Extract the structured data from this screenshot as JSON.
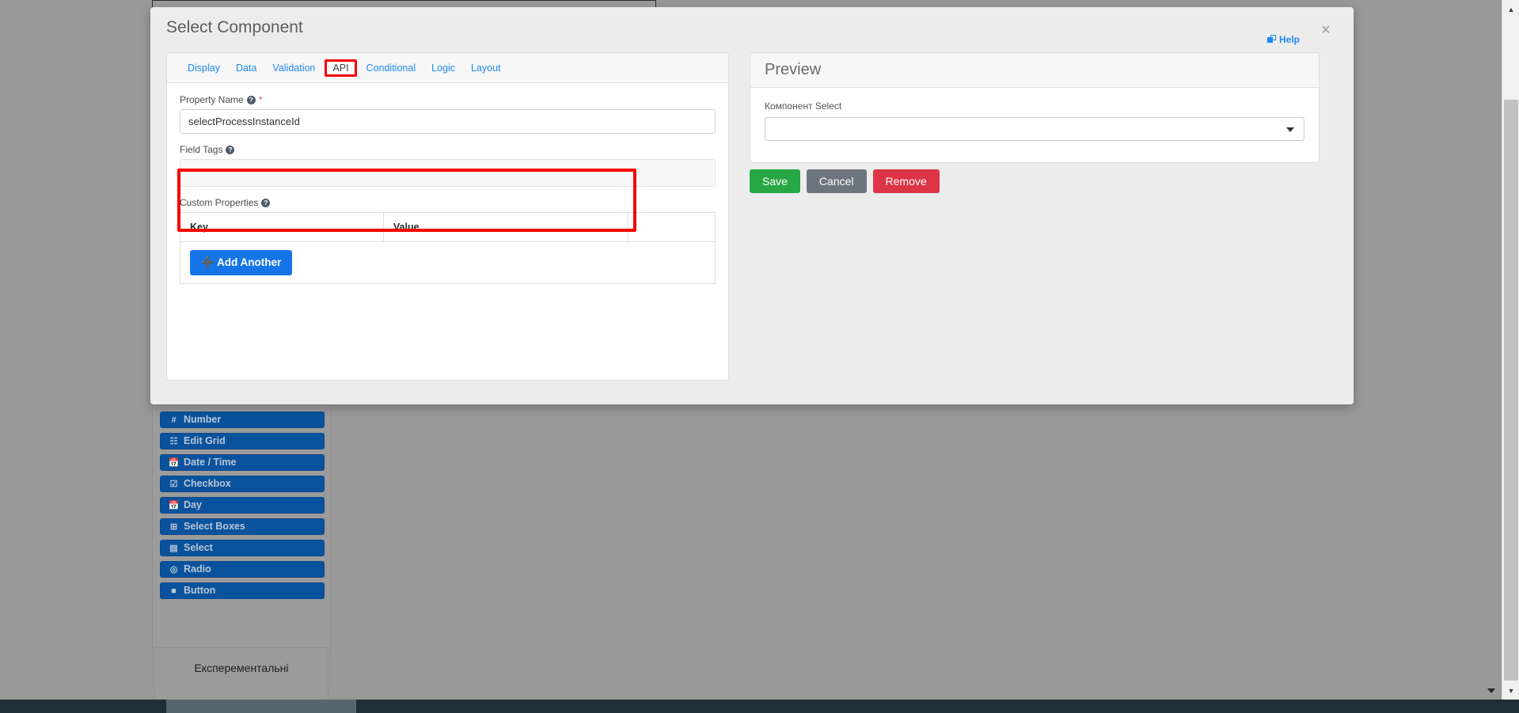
{
  "background": {
    "components_palette": [
      {
        "label": "Number",
        "icon": "hash-icon"
      },
      {
        "label": "Edit Grid",
        "icon": "grid-icon"
      },
      {
        "label": "Date / Time",
        "icon": "calendar-icon"
      },
      {
        "label": "Checkbox",
        "icon": "checkbox-icon"
      },
      {
        "label": "Day",
        "icon": "calendar-icon"
      },
      {
        "label": "Select Boxes",
        "icon": "plus-square-icon"
      },
      {
        "label": "Select",
        "icon": "list-icon"
      },
      {
        "label": "Radio",
        "icon": "radio-icon"
      },
      {
        "label": "Button",
        "icon": "square-icon"
      }
    ],
    "experimental_group_label": "Експерементальні"
  },
  "modal": {
    "title": "Select Component",
    "help_label": "Help",
    "close_label": "×",
    "tabs": [
      {
        "label": "Display",
        "active": false
      },
      {
        "label": "Data",
        "active": false
      },
      {
        "label": "Validation",
        "active": false
      },
      {
        "label": "API",
        "active": true
      },
      {
        "label": "Conditional",
        "active": false
      },
      {
        "label": "Logic",
        "active": false
      },
      {
        "label": "Layout",
        "active": false
      }
    ],
    "api_tab": {
      "property_name": {
        "label": "Property Name",
        "required_marker": "*",
        "help_glyph": "?",
        "value": "selectProcessInstanceId",
        "placeholder": ""
      },
      "field_tags": {
        "label": "Field Tags",
        "help_glyph": "?",
        "value": "",
        "placeholder": ""
      },
      "custom_properties": {
        "label": "Custom Properties",
        "help_glyph": "?",
        "columns": [
          "Key",
          "Value",
          ""
        ],
        "rows": [],
        "add_button_label": "Add Another",
        "add_button_icon": "plus-icon"
      }
    }
  },
  "preview": {
    "title": "Preview",
    "field_label": "Компонент Select",
    "select_value": "",
    "caret_icon": "chevron-down-icon"
  },
  "actions": {
    "save": "Save",
    "cancel": "Cancel",
    "remove": "Remove"
  },
  "colors": {
    "accent_blue": "#1e87f0",
    "save_green": "#28a745",
    "cancel_grey": "#6c757d",
    "remove_red": "#dc3545",
    "highlight_red": "#f40000",
    "add_blue": "#1575e8",
    "palette_blue": "#0b529d"
  },
  "scrollbar": {
    "up_arrow": "▲",
    "down_arrow": "▼"
  }
}
